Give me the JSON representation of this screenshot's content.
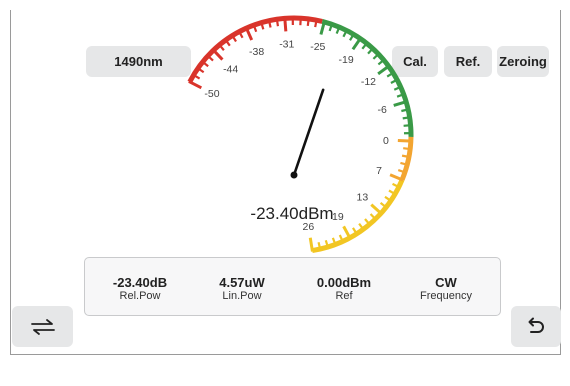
{
  "toolbar": {
    "wavelength_label": "1490nm",
    "cal_label": "Cal.",
    "ref_label": "Ref.",
    "zeroing_label": "Zeroing"
  },
  "gauge": {
    "min": -50,
    "max": 26,
    "value": -23.4,
    "reading": "-23.40dBm",
    "tick_labels": [
      "-50",
      "-44",
      "-38",
      "-31",
      "-25",
      "-19",
      "-12",
      "-6",
      "0",
      "7",
      "13",
      "19",
      "26"
    ],
    "bands": [
      {
        "from": -50,
        "to": -25,
        "color": "#d9342b"
      },
      {
        "from": -25,
        "to": 0,
        "color": "#3a9a47"
      },
      {
        "from": 0,
        "to": 7,
        "color": "#f3a531"
      },
      {
        "from": 7,
        "to": 26,
        "color": "#f2c623"
      }
    ]
  },
  "readings": [
    {
      "value": "-23.40dB",
      "label": "Rel.Pow"
    },
    {
      "value": "4.57uW",
      "label": "Lin.Pow"
    },
    {
      "value": "0.00dBm",
      "label": "Ref"
    },
    {
      "value": "CW",
      "label": "Frequency"
    }
  ],
  "icons": {
    "swap": "swap-arrows-icon",
    "back": "undo-arrow-icon",
    "menu": "triangle-down-icon"
  },
  "colors": {
    "titlebar": "#2b2e33",
    "button": "#e6e7e8",
    "needle": "#111111"
  }
}
